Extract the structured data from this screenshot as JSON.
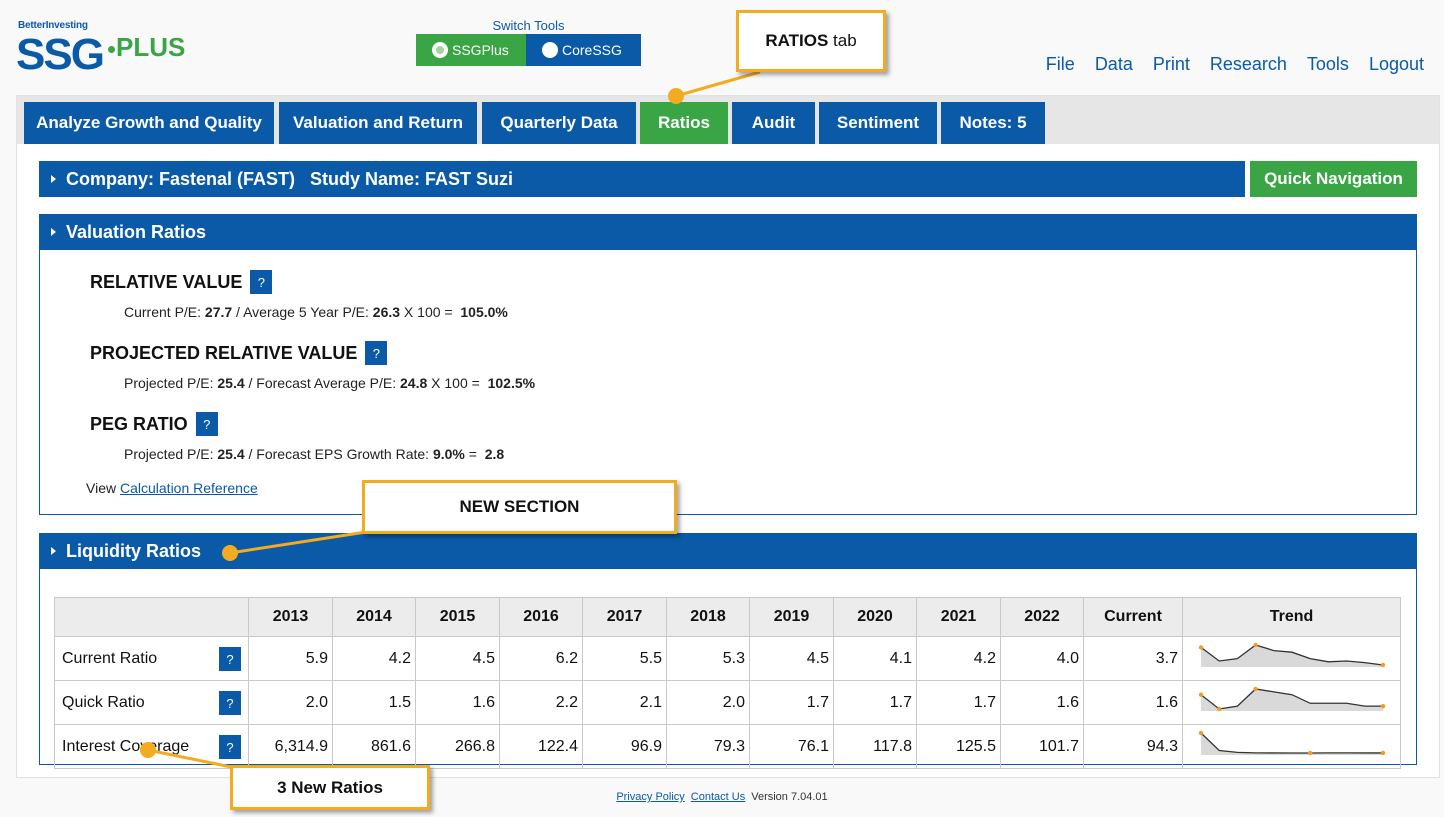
{
  "brand": {
    "better": "BetterInvesting",
    "ssg": "SSG",
    "plus": "PLUS"
  },
  "switch_tools": {
    "title": "Switch Tools",
    "options": [
      "SSGPlus",
      "CoreSSG"
    ]
  },
  "topnav": [
    "File",
    "Data",
    "Print",
    "Research",
    "Tools",
    "Logout"
  ],
  "tabs": [
    "Analyze Growth and Quality",
    "Valuation and Return",
    "Quarterly Data",
    "Ratios",
    "Audit",
    "Sentiment",
    "Notes: 5"
  ],
  "company_bar": "Company: Fastenal (FAST)   Study Name: FAST Suzi",
  "quick_nav": "Quick Navigation",
  "valuation": {
    "title": "Valuation Ratios",
    "relative": {
      "heading": "RELATIVE VALUE",
      "p1": "Current P/E: ",
      "v1": "27.7",
      "p2": " / Average 5 Year P/E: ",
      "v2": "26.3",
      "p3": " X 100 =  ",
      "result": "105.0%"
    },
    "projected": {
      "heading": "PROJECTED RELATIVE VALUE",
      "p1": "Projected P/E: ",
      "v1": "25.4",
      "p2": " / Forecast Average P/E: ",
      "v2": "24.8",
      "p3": " X 100 =  ",
      "result": "102.5%"
    },
    "peg": {
      "heading": "PEG RATIO",
      "p1": "Projected P/E: ",
      "v1": "25.4",
      "p2": " / Forecast EPS Growth Rate: ",
      "v2": "9.0%",
      "p3": " =  ",
      "result": "2.8"
    },
    "view": "View ",
    "calc_link": "Calculation Reference"
  },
  "liquidity": {
    "title": "Liquidity Ratios",
    "headers": [
      "2013",
      "2014",
      "2015",
      "2016",
      "2017",
      "2018",
      "2019",
      "2020",
      "2021",
      "2022",
      "Current",
      "Trend"
    ],
    "rows": [
      {
        "label": "Current Ratio",
        "values": [
          "5.9",
          "4.2",
          "4.5",
          "6.2",
          "5.5",
          "5.3",
          "4.5",
          "4.1",
          "4.2",
          "4.0",
          "3.7"
        ]
      },
      {
        "label": "Quick Ratio",
        "values": [
          "2.0",
          "1.5",
          "1.6",
          "2.2",
          "2.1",
          "2.0",
          "1.7",
          "1.7",
          "1.7",
          "1.6",
          "1.6"
        ]
      },
      {
        "label": "Interest Coverage",
        "values": [
          "6,314.9",
          "861.6",
          "266.8",
          "122.4",
          "96.9",
          "79.3",
          "76.1",
          "117.8",
          "125.5",
          "101.7",
          "94.3"
        ]
      }
    ],
    "help": "?"
  },
  "callouts": {
    "ratios_bold": "RATIOS",
    "ratios_rest": " tab",
    "new_section": "NEW SECTION",
    "new_ratios": "3 New Ratios"
  },
  "footer": {
    "privacy": "Privacy Policy",
    "contact": "Contact Us",
    "version": "Version 7.04.01"
  },
  "colors": {
    "primary": "#0a5aa8",
    "accent": "#3aa545",
    "callout": "#f3ab1f"
  }
}
